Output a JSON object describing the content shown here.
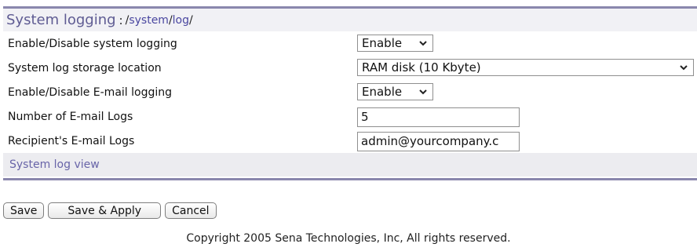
{
  "header": {
    "title": "System logging",
    "separator": ":",
    "path_prefix": "/",
    "path_part1": "system",
    "path_mid": "/",
    "path_part2": "log",
    "path_suffix": "/"
  },
  "form": {
    "rows": [
      {
        "label": "Enable/Disable system logging",
        "value": "Enable"
      },
      {
        "label": "System log storage location",
        "value": "RAM disk (10 Kbyte)"
      },
      {
        "label": "Enable/Disable E-mail logging",
        "value": "Enable"
      },
      {
        "label": "Number of E-mail Logs",
        "value": "5"
      },
      {
        "label": "Recipient's E-mail Logs",
        "value": "admin@yourcompany.c"
      }
    ],
    "view_link": "System log view"
  },
  "buttons": {
    "save": "Save",
    "save_apply": "Save & Apply",
    "cancel": "Cancel"
  },
  "footer": {
    "copyright": "Copyright 2005 Sena Technologies, Inc, All rights reserved."
  }
}
